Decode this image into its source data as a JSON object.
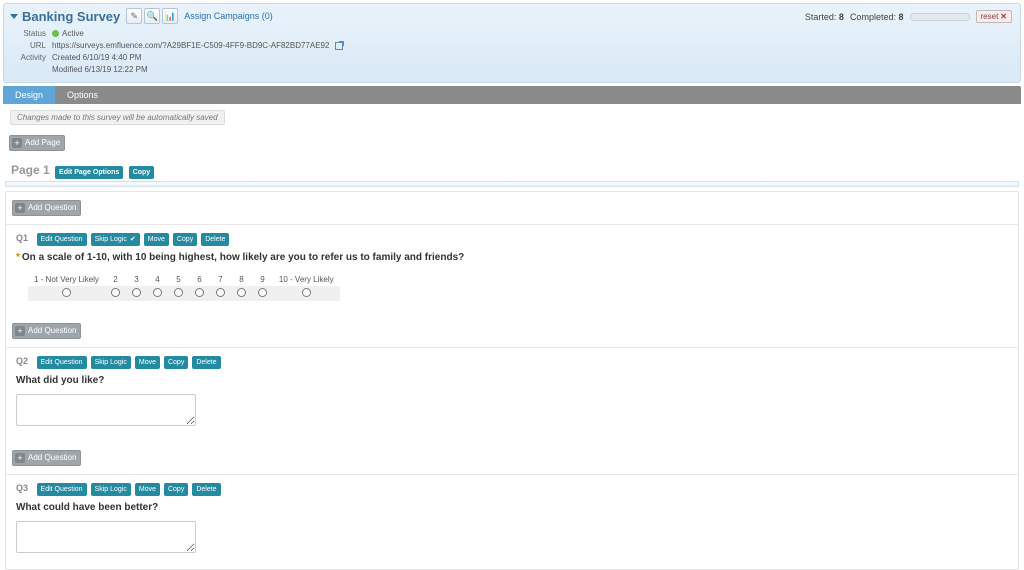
{
  "header": {
    "title": "Banking Survey",
    "icons": {
      "edit": "✎",
      "search": "🔍",
      "chart": "📊"
    },
    "assign_link": "Assign Campaigns (0)",
    "stats": {
      "started_label": "Started:",
      "started_value": "8",
      "completed_label": "Completed:",
      "completed_value": "8"
    },
    "reset": "reset",
    "meta": {
      "status_label": "Status",
      "status_value": "Active",
      "url_label": "URL",
      "url_value": "https://surveys.emfluence.com/?A29BF1E-C509-4FF9-BD9C-AF82BD77AE92",
      "activity_label": "Activity",
      "activity_created": "Created 6/10/19 4:40 PM",
      "activity_modified": "Modified 6/13/19 12:22 PM"
    }
  },
  "tabs": {
    "design": "Design",
    "options": "Options"
  },
  "autosave_note": "Changes made to this survey will be automatically saved",
  "buttons": {
    "add_page": "Add Page",
    "add_question": "Add Question",
    "edit_page_options": "Edit Page Options",
    "copy": "Copy",
    "edit_question": "Edit Question",
    "skip_logic": "Skip Logic",
    "move": "Move",
    "delete": "Delete"
  },
  "page": {
    "label": "Page 1"
  },
  "questions": {
    "q1": {
      "num": "Q1",
      "text": "On a scale of 1-10, with 10 being highest, how likely are you to refer us to family and friends?",
      "skip_logic_applied": true,
      "scale_labels": [
        "1 - Not Very Likely",
        "2",
        "3",
        "4",
        "5",
        "6",
        "7",
        "8",
        "9",
        "10 - Very Likely"
      ]
    },
    "q2": {
      "num": "Q2",
      "text": "What did you like?"
    },
    "q3": {
      "num": "Q3",
      "text": "What could have been better?"
    }
  }
}
